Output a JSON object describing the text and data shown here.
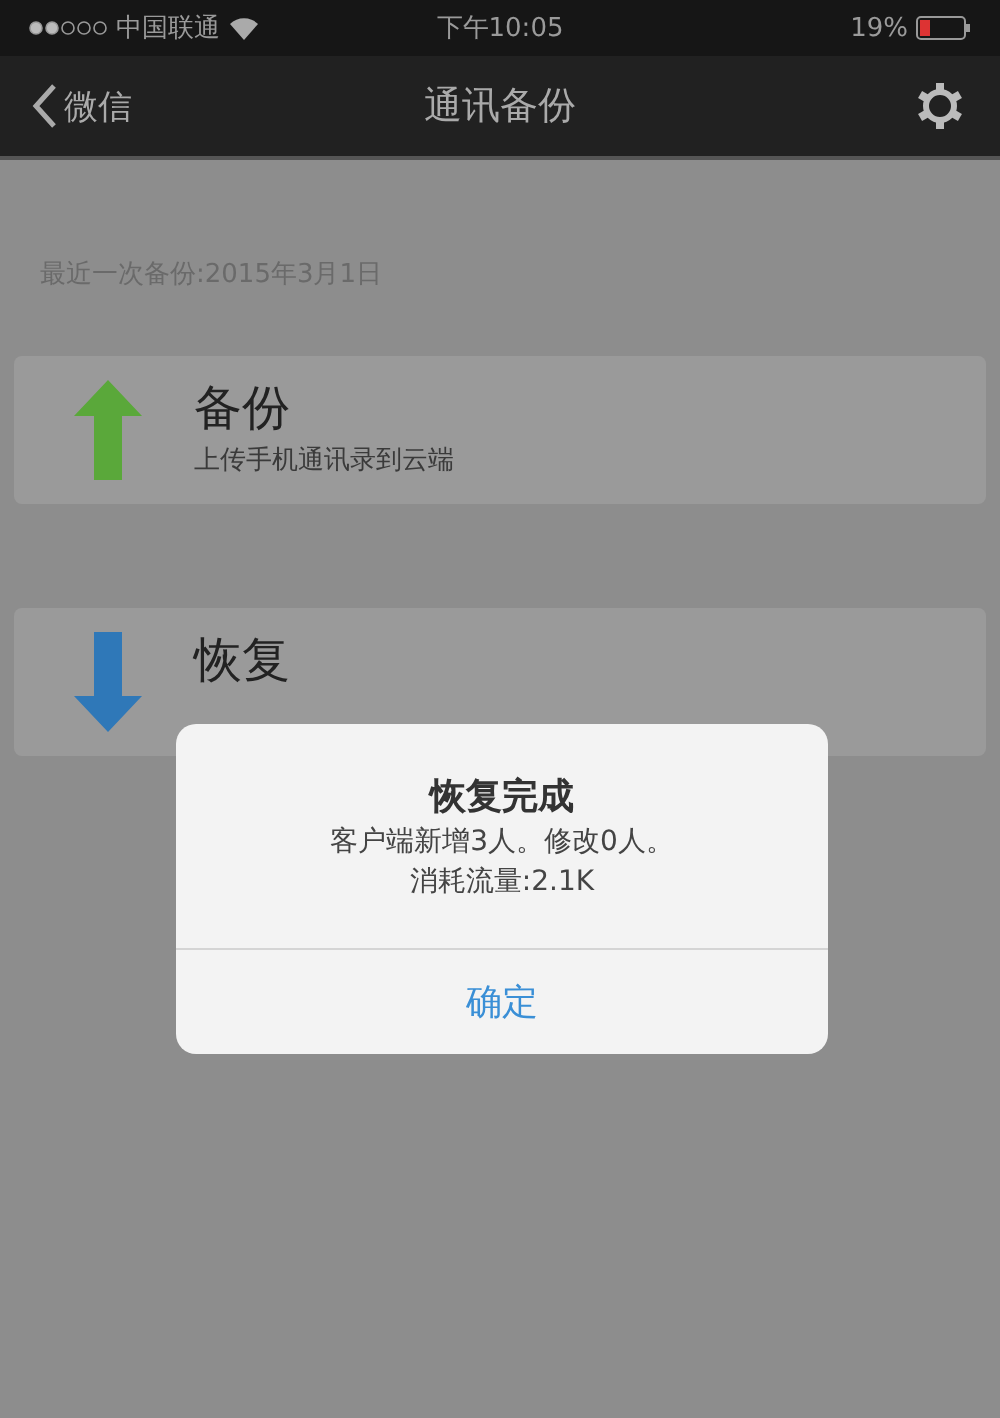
{
  "status_bar": {
    "carrier": "中国联通",
    "time": "下午10:05",
    "battery": "19%"
  },
  "nav_bar": {
    "back": "微信",
    "title": "通讯备份"
  },
  "last_backup": "最近一次备份:2015年3月1日",
  "actions": [
    {
      "kind": "upload",
      "title": "备份",
      "subtitle": "上传手机通讯录到云端"
    },
    {
      "kind": "download",
      "title": "恢复"
    }
  ],
  "dialog": {
    "title": "恢复完成",
    "lines": [
      "客户端新增3人。修改0人。",
      "消耗流量:2.1K"
    ],
    "button": "确定"
  }
}
